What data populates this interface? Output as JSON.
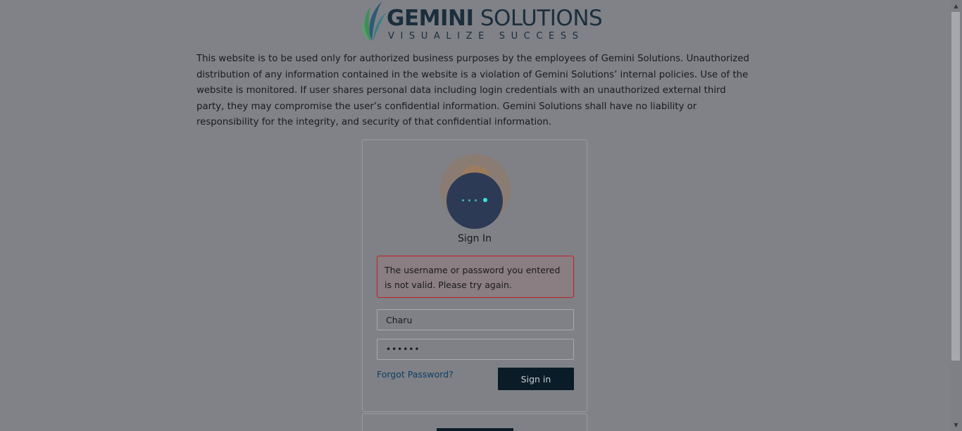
{
  "logo": {
    "title_bold": "GEMINI",
    "title_rest": " SOLUTIONS",
    "tagline": "VISUALIZE SUCCESS",
    "icon": "leaf-logo-icon"
  },
  "disclaimer": "This website is to be used only for authorized business purposes by the employees of Gemini Solutions. Unauthorized distribution of any information contained in the website is a violation of Gemini Solutions’ internal policies. Use of the website is monitored. If user shares personal data including login credentials with an unauthorized external third party, they may compromise the user’s confidential information. Gemini Solutions shall have no liability or responsibility for the integrity, and security of that confidential information.",
  "login": {
    "title": "Sign In",
    "error": "The username or password you entered is not valid. Please try again.",
    "username_value": "Charu",
    "password_value": "••••••",
    "forgot_label": "Forgot Password?",
    "signin_label": "Sign in",
    "avatar_icon": "user-avatar-icon",
    "spinner_icon": "loading-dots-icon"
  },
  "colors": {
    "overlay": "#808288",
    "button": "#0a1c28",
    "error_border": "#c02024",
    "link": "#0e3d66"
  }
}
